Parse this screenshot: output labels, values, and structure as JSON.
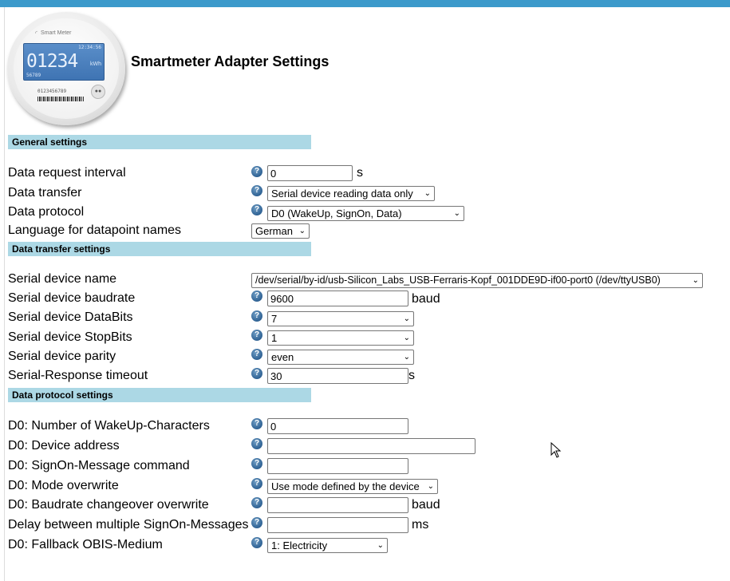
{
  "page": {
    "title": "Smartmeter Adapter Settings"
  },
  "logo": {
    "brand": "Smart Meter",
    "time": "12:34:56",
    "reading": "01234",
    "unit": "kWh",
    "sub": "56789",
    "serial": "0123456789",
    "button_icon": "dots-icon"
  },
  "sections": {
    "general": "General settings",
    "transfer": "Data transfer settings",
    "protocol": "Data protocol settings"
  },
  "general": {
    "request_interval": {
      "label": "Data request interval",
      "value": "0",
      "unit": "s"
    },
    "data_transfer": {
      "label": "Data transfer",
      "value": "Serial device reading data only"
    },
    "data_protocol": {
      "label": "Data protocol",
      "value": "D0 (WakeUp, SignOn, Data)"
    },
    "language": {
      "label": "Language for datapoint names",
      "value": "German"
    }
  },
  "transfer": {
    "device_name": {
      "label": "Serial device name",
      "value": "/dev/serial/by-id/usb-Silicon_Labs_USB-Ferraris-Kopf_001DDE9D-if00-port0 (/dev/ttyUSB0)"
    },
    "baudrate": {
      "label": "Serial device baudrate",
      "value": "9600",
      "unit": "baud"
    },
    "databits": {
      "label": "Serial device DataBits",
      "value": "7"
    },
    "stopbits": {
      "label": "Serial device StopBits",
      "value": "1"
    },
    "parity": {
      "label": "Serial device parity",
      "value": "even"
    },
    "timeout": {
      "label": "Serial-Response timeout",
      "value": "30",
      "unit": "s"
    }
  },
  "protocol": {
    "wakeup_chars": {
      "label": "D0: Number of WakeUp-Characters",
      "value": "0"
    },
    "device_address": {
      "label": "D0: Device address",
      "value": ""
    },
    "signon_cmd": {
      "label": "D0: SignOn-Message command",
      "value": ""
    },
    "mode_overwrite": {
      "label": "D0: Mode overwrite",
      "value": "Use mode defined by the device"
    },
    "baud_changeover": {
      "label": "D0: Baudrate changeover overwrite",
      "value": "",
      "unit": "baud"
    },
    "signon_delay": {
      "label": "Delay between multiple SignOn-Messages",
      "value": "",
      "unit": "ms"
    },
    "fallback_obis": {
      "label": "D0: Fallback OBIS-Medium",
      "value": "1: Electricity"
    }
  },
  "colors": {
    "topbar": "#3c9acb",
    "section_header": "#acd8e5",
    "help_icon": "#2f6294"
  }
}
